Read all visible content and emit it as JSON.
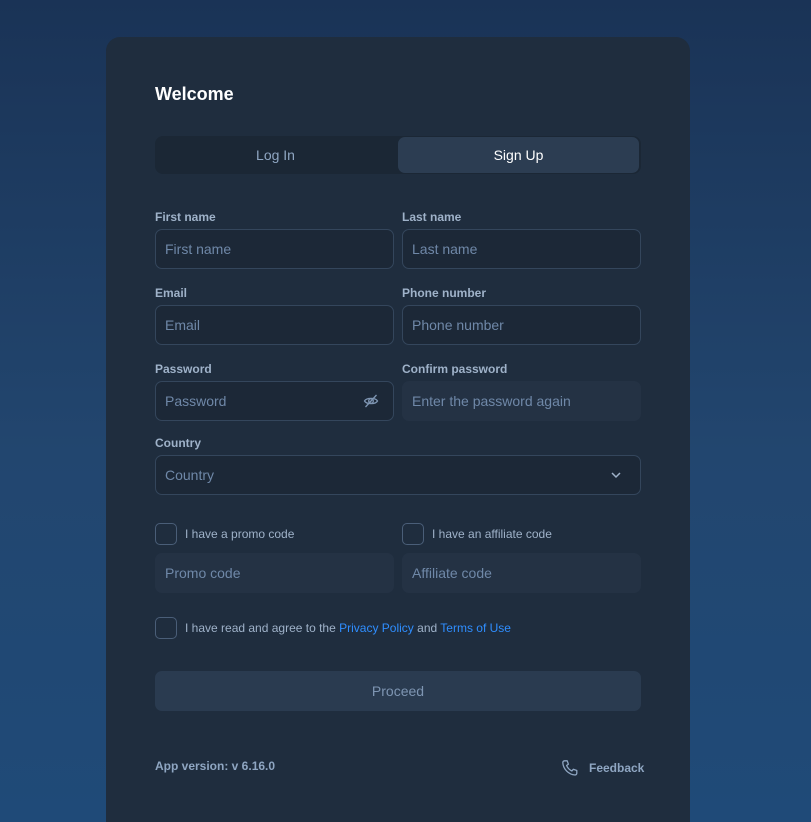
{
  "title": "Welcome",
  "tabs": [
    {
      "label": "Log In",
      "active": false
    },
    {
      "label": "Sign Up",
      "active": true
    }
  ],
  "form": {
    "first_name": {
      "label": "First name",
      "placeholder": "First name",
      "value": ""
    },
    "last_name": {
      "label": "Last name",
      "placeholder": "Last name",
      "value": ""
    },
    "email": {
      "label": "Email",
      "placeholder": "Email",
      "value": ""
    },
    "phone": {
      "label": "Phone number",
      "placeholder": "Phone number",
      "value": ""
    },
    "password": {
      "label": "Password",
      "placeholder": "Password",
      "value": "",
      "icon": "eye-off-icon"
    },
    "confirm_password": {
      "label": "Confirm password",
      "placeholder": "Enter the password again",
      "value": ""
    },
    "country": {
      "label": "Country",
      "placeholder": "Country",
      "value": "",
      "icon": "chevron-down-icon"
    }
  },
  "promo": {
    "checkbox_label": "I have a promo code",
    "placeholder": "Promo code",
    "checked": false
  },
  "affiliate": {
    "checkbox_label": "I have an affiliate code",
    "placeholder": "Affiliate code",
    "checked": false
  },
  "agreement": {
    "text_before": "I have read and agree to the ",
    "privacy_link": "Privacy Policy",
    "and_text": " and ",
    "terms_link": "Terms of Use",
    "checked": false
  },
  "proceed_label": "Proceed",
  "footer": {
    "version": "App version: v 6.16.0",
    "feedback_label": "Feedback",
    "feedback_icon": "phone-icon"
  },
  "colors": {
    "card": "#1f2d3e",
    "accent_link": "#2f8eff",
    "label": "#9fb2c9"
  }
}
